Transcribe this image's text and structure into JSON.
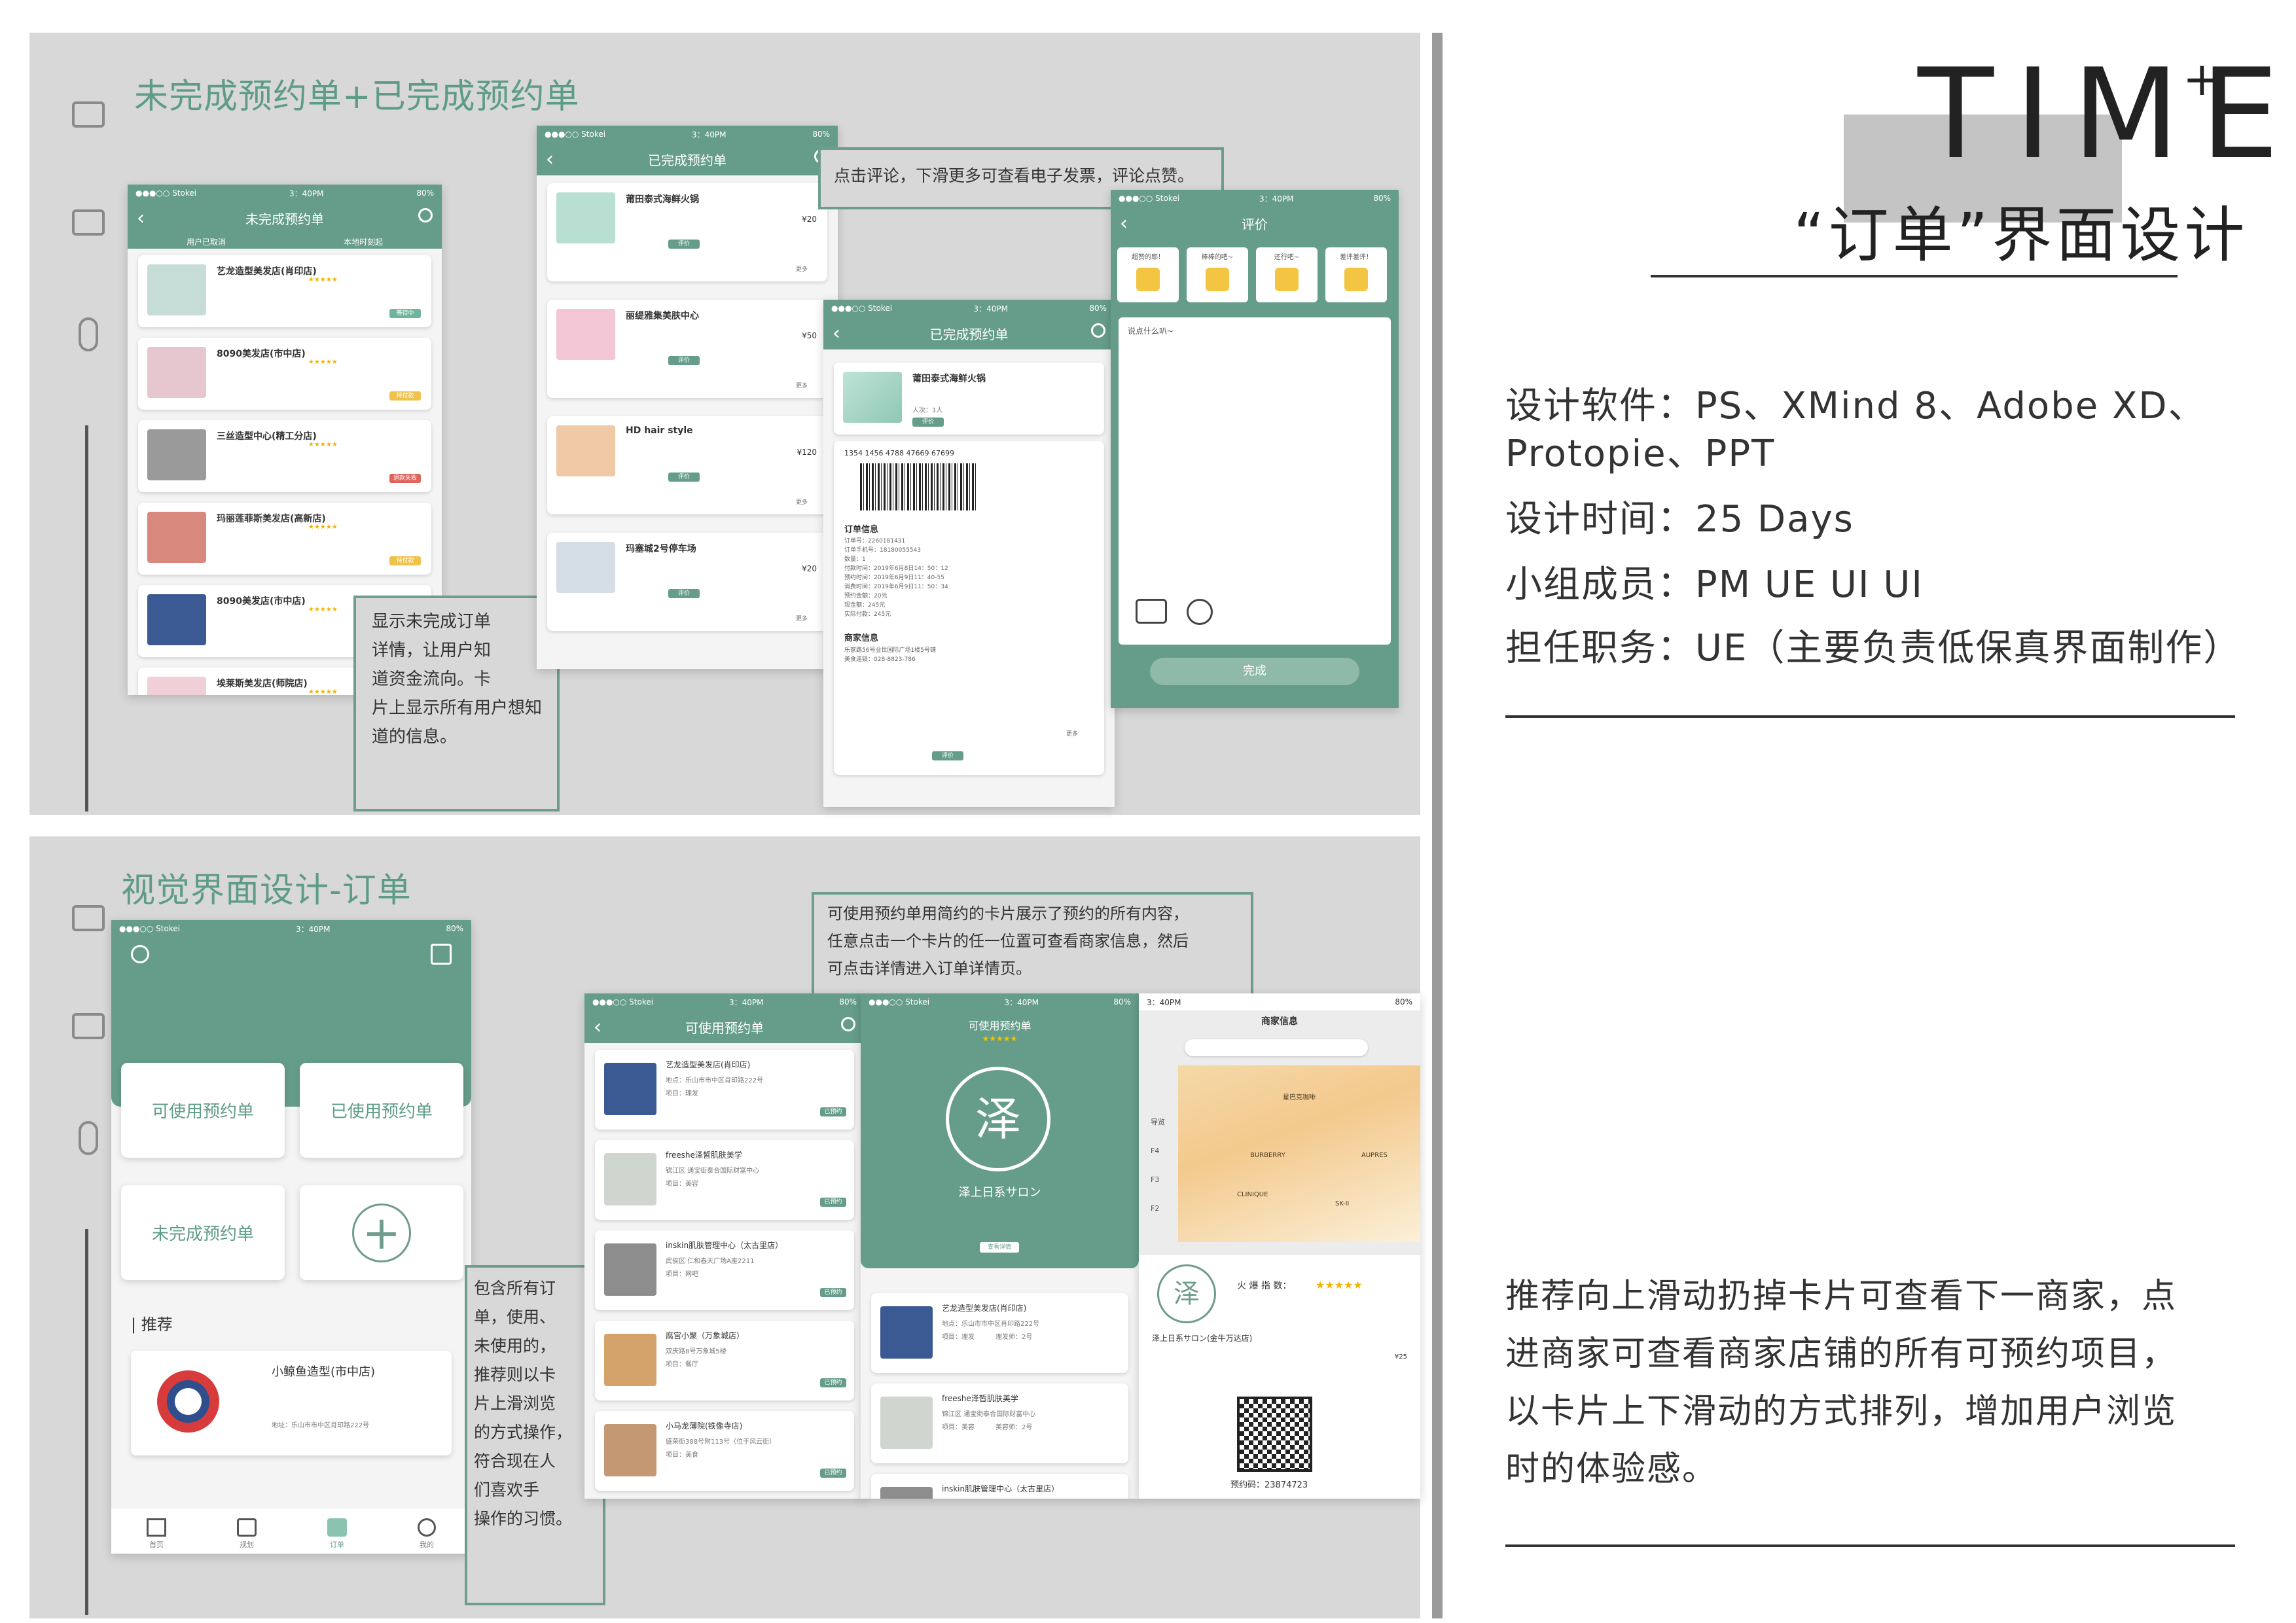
{
  "brand": {
    "title": "TIME",
    "superscript": "+",
    "subtitle": "“订单”界面设计"
  },
  "info": {
    "software": "设计软件：PS、XMind 8、Adobe XD、",
    "software2": "Protopie、PPT",
    "time": "设计时间：25 Days",
    "members": "小组成员：PM UE UI UI",
    "role": "担任职务：UE（主要负责低保真界面制作）"
  },
  "description": [
    "推荐向上滑动扔掉卡片可查看下一商家，点",
    "进商家可查看商家店铺的所有可预约项目，",
    "以卡片上下滑动的方式排列，增加用户浏览",
    "时的体验感。"
  ],
  "section1": {
    "title": "未完成预约单+已完成预约单",
    "callout_left": [
      "显示未完成订单",
      "详情，让用户知",
      "道资金流向。卡",
      "片上显示所有用户想知",
      "道的信息。"
    ],
    "callout_top": "点击评论，下滑更多可查看电子发票，评论点赞。",
    "phone_pending": {
      "status_left": "●●●○○ Stokei",
      "status_time": "3：40PM",
      "status_right": "80%",
      "title": "未完成预约单",
      "tab1": "用户已取消",
      "tab2": "本地时刻起",
      "shops": [
        {
          "name": "艺龙造型美发店(肖印店)",
          "pill": "等待中"
        },
        {
          "name": "8090美发店(市中店)",
          "pill": "待付款"
        },
        {
          "name": "三丝造型中心(精工分店)",
          "pill": "退款失败"
        },
        {
          "name": "玛丽莲菲斯美发店(高新店)",
          "pill": "待付款"
        },
        {
          "name": "8090美发店(市中店)",
          "pill": "等待中"
        },
        {
          "name": "埃莱斯美发店(师院店)",
          "pill": ""
        }
      ]
    },
    "phone_done": {
      "status_left": "●●●○○ Stokei",
      "status_time": "3：40PM",
      "status_right": "80%",
      "title": "已完成预约单",
      "items": [
        {
          "name": "莆田泰式海鲜火锅",
          "price": "¥20",
          "btn": "评价",
          "more": "更多"
        },
        {
          "name": "丽缇雅集美肤中心",
          "price": "¥50",
          "btn": "评价",
          "more": "更多"
        },
        {
          "name": "HD hair style",
          "price": "¥120",
          "btn": "评价",
          "more": "更多"
        },
        {
          "name": "玛塞城2号停车场",
          "price": "¥20",
          "btn": "评价",
          "more": "更多"
        }
      ]
    },
    "phone_detail": {
      "status_left": "●●●○○ Stokei",
      "status_time": "3：40PM",
      "status_right": "80%",
      "title": "已完成预约单",
      "shop": "莆田泰式海鲜火锅",
      "people": "人次：1人",
      "barcode_no": "1354 1456 4788 47669 67699",
      "order_info": "订单信息",
      "order_lines": [
        "订单号：2260181431",
        "订单手机号：18180055543",
        "数量：1",
        "付款时间：2019年6月8日14：50：12",
        "预约时间：2019年6月9日11：40-55",
        "消费时间：2019年6月9日11：50：34",
        "预约金额：20元",
        "现金额：245元",
        "实际付款：245元"
      ],
      "merchant_info": "商家信息",
      "merchant_lines": [
        "乐家路56号业世国际广场1楼5号铺",
        "美食连锁：028-8823-786"
      ],
      "btn": "评价",
      "more": "更多"
    },
    "phone_review": {
      "status_left": "●●●○○ Stokei",
      "status_time": "3：40PM",
      "status_right": "80%",
      "title": "评价",
      "chips": [
        "超赞的耶！",
        "棒棒的吧~",
        "还行吧~",
        "差评差评！"
      ],
      "placeholder": "说点什么叭~",
      "done": "完成"
    }
  },
  "section2": {
    "title": "视觉界面设计-订单",
    "callout_left": [
      "包含所有订",
      "单，使用、",
      "未使用的，",
      "推荐则以卡",
      "片上滑浏览",
      "的方式操作，",
      "符合现在人",
      "们喜欢手",
      "操作的习惯。"
    ],
    "callout_top": [
      "可使用预约单用简约的卡片展示了预约的所有内容，",
      "任意点击一个卡片的任一位置可查看商家信息，然后",
      "可点击详情进入订单详情页。"
    ],
    "phone_home": {
      "status_left": "●●●○○ Stokei",
      "status_time": "3：40PM",
      "status_right": "80%",
      "btn_usable": "可使用预约单",
      "btn_used": "已使用预约单",
      "btn_pending": "未完成预约单",
      "recommend": "推荐",
      "rec_shop": "小鲸鱼造型(市中店)",
      "rec_addr": "地址：乐山市市中区肖印路222号",
      "tabs": [
        "首页",
        "规划",
        "订单",
        "我的"
      ]
    },
    "phone_usable": {
      "status_left": "●●●○○ Stokei",
      "status_time": "3：40PM",
      "status_right": "80%",
      "title": "可使用预约单",
      "items": [
        {
          "name": "艺龙造型美发店(肖印店)",
          "addr": "地点：乐山市市中区肖印路222号",
          "proj": "项目：理发",
          "tag": "已预约"
        },
        {
          "name": "freeshe泽皙肌肤美学",
          "addr": "锦江区 通宝街泰合国际财富中心",
          "proj": "项目：美容",
          "tag": "已预约"
        },
        {
          "name": "inskin肌肤管理中心（太古里店）",
          "addr": "武侯区 仁和春天广场A座2211",
          "proj": "项目：网吧",
          "tag": "已预约"
        },
        {
          "name": "腐宫小聚（万象城店）",
          "addr": "双庆路8号万象城5楼",
          "proj": "项目：餐厅",
          "tag": "已预约"
        },
        {
          "name": "小马龙薄院(铁像寺店)",
          "addr": "盛荣街388号附113号（位于风云街）",
          "proj": "项目：美食",
          "tag": "已预约"
        }
      ]
    },
    "phone_shop": {
      "status_left": "●●●○○ Stokei",
      "status_time": "3：40PM",
      "status_right": "80%",
      "title": "可使用预约单",
      "logo_text": "泽上日系サロン",
      "detail_btn": "查看详情",
      "items": [
        {
          "name": "艺龙造型美发店(肖印店)",
          "addr": "地点：乐山市市中区肖印路222号",
          "proj": "项目：理发",
          "tech": "理发师：2号"
        },
        {
          "name": "freeshe泽皙肌肤美学",
          "addr": "锦江区 通宝街泰合国际财富中心",
          "proj": "项目：美容",
          "tech": "美容师：2号"
        },
        {
          "name": "inskin肌肤管理中心（太古里店）",
          "addr": "",
          "proj": "",
          "tech": ""
        }
      ]
    },
    "phone_map": {
      "status_time": "3：40PM",
      "status_right": "80%",
      "title": "商家信息",
      "stores": [
        "星巴克咖啡",
        "BURBERRY",
        "AUPRES",
        "CLINIQUE",
        "SK-II"
      ],
      "floors": [
        "导览",
        "F4",
        "F3",
        "F2"
      ],
      "hot": "火 爆 指 数：",
      "hot_stars": "★★★★★",
      "shop": "泽上日系サロン(金牛万达店)",
      "price": "¥25",
      "code": "预约码：23874723"
    }
  },
  "colors": {
    "accent": "#669d8a",
    "panel": "#d8d8d8",
    "text": "#333333"
  }
}
